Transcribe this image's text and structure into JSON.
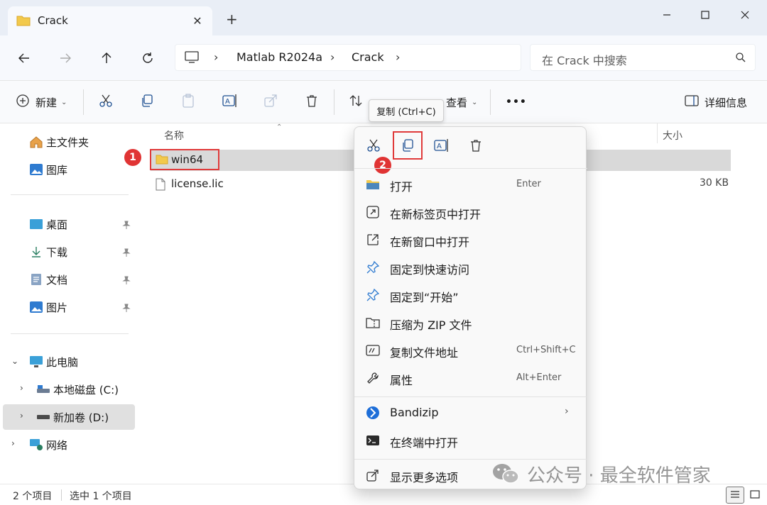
{
  "window": {
    "tab_title": "Crack",
    "new_tab_symbol": "+"
  },
  "address": {
    "crumbs": [
      "Matlab R2024a",
      "Crack"
    ],
    "search_placeholder": "在 Crack 中搜索"
  },
  "toolbar": {
    "new_label": "新建",
    "view_label": "查看",
    "more_label": "•••",
    "details_label": "详细信息"
  },
  "sidebar": {
    "home": "主文件夹",
    "gallery": "图库",
    "desktop": "桌面",
    "downloads": "下载",
    "documents": "文档",
    "pictures": "图片",
    "this_pc": "此电脑",
    "drive_c": "本地磁盘 (C:)",
    "drive_d": "新加卷 (D:)",
    "network": "网络"
  },
  "files": {
    "col_name": "名称",
    "col_size": "大小",
    "rows": [
      {
        "name": "win64",
        "size": ""
      },
      {
        "name": "license.lic",
        "size": "30 KB"
      }
    ]
  },
  "annotations": {
    "step1": "1",
    "step2": "2",
    "highlight_color": "#e03a3a"
  },
  "tooltip": "复制 (Ctrl+C)",
  "context_menu": {
    "items": [
      {
        "label": "打开",
        "shortcut": "Enter"
      },
      {
        "label": "在新标签页中打开",
        "shortcut": ""
      },
      {
        "label": "在新窗口中打开",
        "shortcut": ""
      },
      {
        "label": "固定到快速访问",
        "shortcut": ""
      },
      {
        "label": "固定到“开始”",
        "shortcut": ""
      },
      {
        "label": "压缩为 ZIP 文件",
        "shortcut": ""
      },
      {
        "label": "复制文件地址",
        "shortcut": "Ctrl+Shift+C"
      },
      {
        "label": "属性",
        "shortcut": "Alt+Enter"
      },
      {
        "label": "Bandizip",
        "shortcut": ""
      },
      {
        "label": "在终端中打开",
        "shortcut": ""
      },
      {
        "label": "显示更多选项",
        "shortcut": ""
      }
    ]
  },
  "status": {
    "count": "2 个项目",
    "selected": "选中 1 个项目"
  },
  "watermark": {
    "text": "公众号 · 最全软件管家"
  },
  "colors": {
    "folder": "#f2c94c",
    "accent": "#0067c0",
    "annotation_red": "#e03434"
  }
}
